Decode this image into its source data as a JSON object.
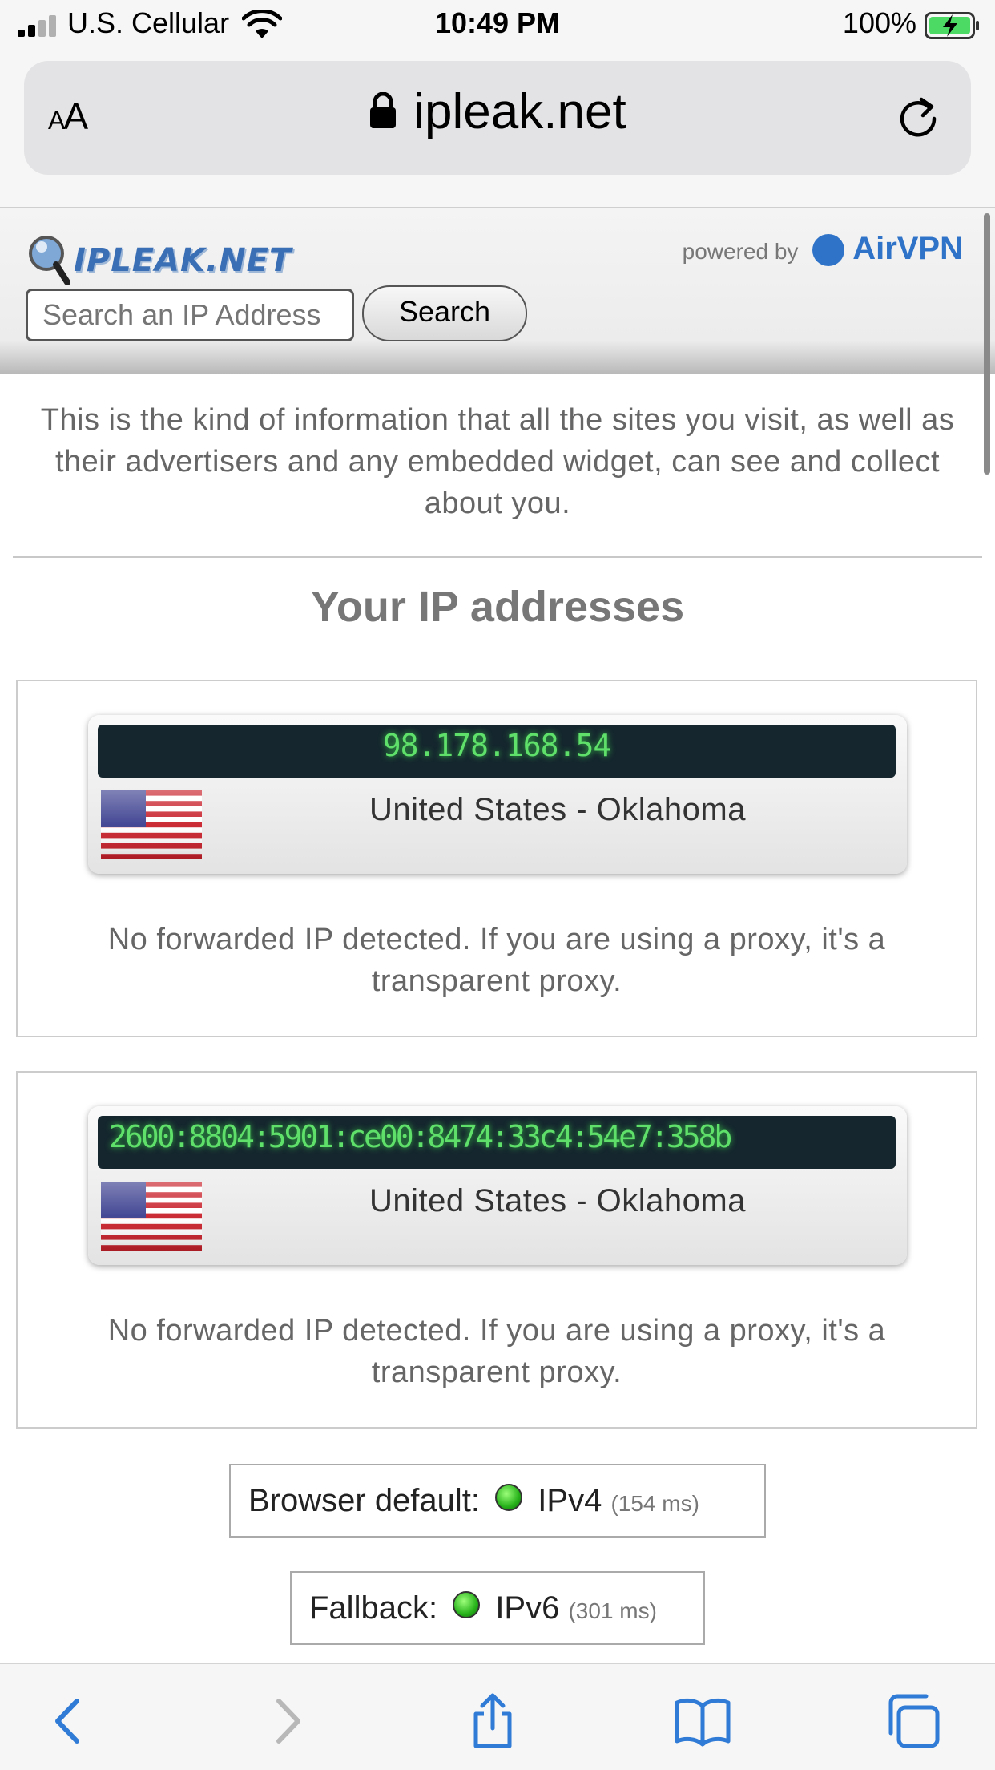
{
  "status_bar": {
    "carrier": "U.S. Cellular",
    "time": "10:49 PM",
    "battery": "100%"
  },
  "address_bar": {
    "text_size_button": "AA",
    "url": "ipleak.net"
  },
  "site": {
    "logo_text": "IPLEAK.NET",
    "powered_by": "powered by",
    "brand": "AirVPN",
    "search_placeholder": "Search an IP Address",
    "search_button": "Search",
    "intro": "This is the kind of information that all the sites you visit, as well as their advertisers and any embedded widget, can see and collect about you.",
    "section_title": "Your IP addresses"
  },
  "ip_addresses": [
    {
      "ip": "98.178.168.54",
      "location": "United States - Oklahoma",
      "note": "No forwarded IP detected. If you are using a proxy, it's a transparent proxy."
    },
    {
      "ip": "2600:8804:5901:ce00:8474:33c4:54e7:358b",
      "location": "United States - Oklahoma",
      "note": "No forwarded IP detected. If you are using a proxy, it's a transparent proxy."
    }
  ],
  "connectivity": {
    "default_label": "Browser default:",
    "default_proto": "IPv4",
    "default_ms": "(154 ms)",
    "fallback_label": "Fallback:",
    "fallback_proto": "IPv6",
    "fallback_ms": "(301 ms)"
  },
  "colors": {
    "ip_green": "#5fe06a",
    "ip_strip_bg": "#15262e",
    "toolbar_blue": "#2f7bd6",
    "brand_blue": "#2f73c8"
  },
  "toolbar": {
    "icons": [
      "back-icon",
      "forward-icon",
      "share-icon",
      "bookmarks-icon",
      "tabs-icon"
    ]
  }
}
